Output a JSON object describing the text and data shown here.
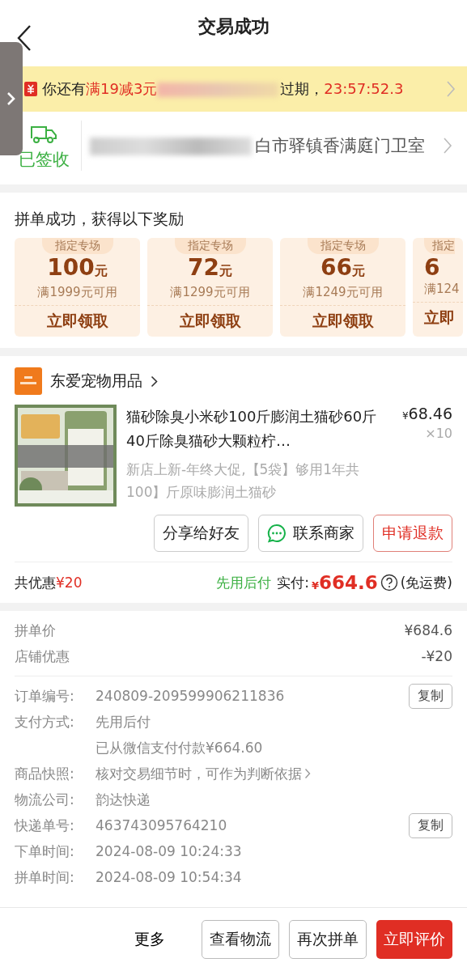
{
  "header": {
    "title": "交易成功"
  },
  "coupon_banner": {
    "prefix": "你还有",
    "offer": "满19减3元",
    "suffix": "过期，",
    "countdown": "23:57:52.3"
  },
  "delivery": {
    "status": "已签收",
    "address": "白市驿镇香满庭门卫室"
  },
  "rewards": {
    "title": "拼单成功，获得以下奖励",
    "coupons": [
      {
        "tag": "指定专场",
        "amount": "100",
        "unit": "元",
        "condition": "满1999元可用",
        "action": "立即领取",
        "cut": false
      },
      {
        "tag": "指定专场",
        "amount": "72",
        "unit": "元",
        "condition": "满1299元可用",
        "action": "立即领取",
        "cut": false
      },
      {
        "tag": "指定专场",
        "amount": "66",
        "unit": "元",
        "condition": "满1249元可用",
        "action": "立即领取",
        "cut": false
      },
      {
        "tag": "指定",
        "amount": "6",
        "condition": "满124",
        "action": "立即",
        "cut": true
      }
    ]
  },
  "shop": {
    "name": "东爱宠物用品"
  },
  "product": {
    "title": "猫砂除臭小米砂100斤膨润土猫砂60斤40斤除臭猫砂大颗粒柠…",
    "price_symbol": "¥",
    "price": "68.46",
    "quantity": "×10",
    "spec": "新店上新-年终大促,【5袋】够用1年共100】斤原味膨润土猫砂"
  },
  "product_actions": [
    {
      "label": "分享给好友",
      "kind": "plain"
    },
    {
      "label": "联系商家",
      "kind": "chat"
    },
    {
      "label": "申请退款",
      "kind": "danger"
    }
  ],
  "summary": {
    "discount_label": "共优惠",
    "discount": "¥20",
    "pay_mode": "先用后付",
    "paid_label": "实付:",
    "currency": "¥",
    "paid": "664.6",
    "shipping": "(免运费)"
  },
  "price_rows": [
    {
      "label": "拼单价",
      "value": "¥684.6"
    },
    {
      "label": "店铺优惠",
      "value": "-¥20"
    }
  ],
  "details": [
    {
      "label": "订单编号:",
      "value": "240809-209599906211836",
      "copy": "复制"
    },
    {
      "label": "支付方式:",
      "value": "先用后付"
    },
    {
      "value": "已从微信支付付款¥664.60"
    },
    {
      "label": "商品快照:",
      "value": "核对交易细节时，可作为判断依据",
      "link": true
    },
    {
      "label": "物流公司:",
      "value": "韵达快递"
    },
    {
      "label": "快递单号:",
      "value": "463743095764210",
      "copy": "复制"
    },
    {
      "label": "下单时间:",
      "value": "2024-08-09 10:24:33"
    },
    {
      "label": "拼单时间:",
      "value": "2024-08-09 10:54:34"
    }
  ],
  "bottom_bar": [
    {
      "label": "更多",
      "kind": "text"
    },
    {
      "label": "查看物流",
      "kind": "outline"
    },
    {
      "label": "再次拼单",
      "kind": "outline"
    },
    {
      "label": "立即评价",
      "kind": "primary"
    }
  ]
}
